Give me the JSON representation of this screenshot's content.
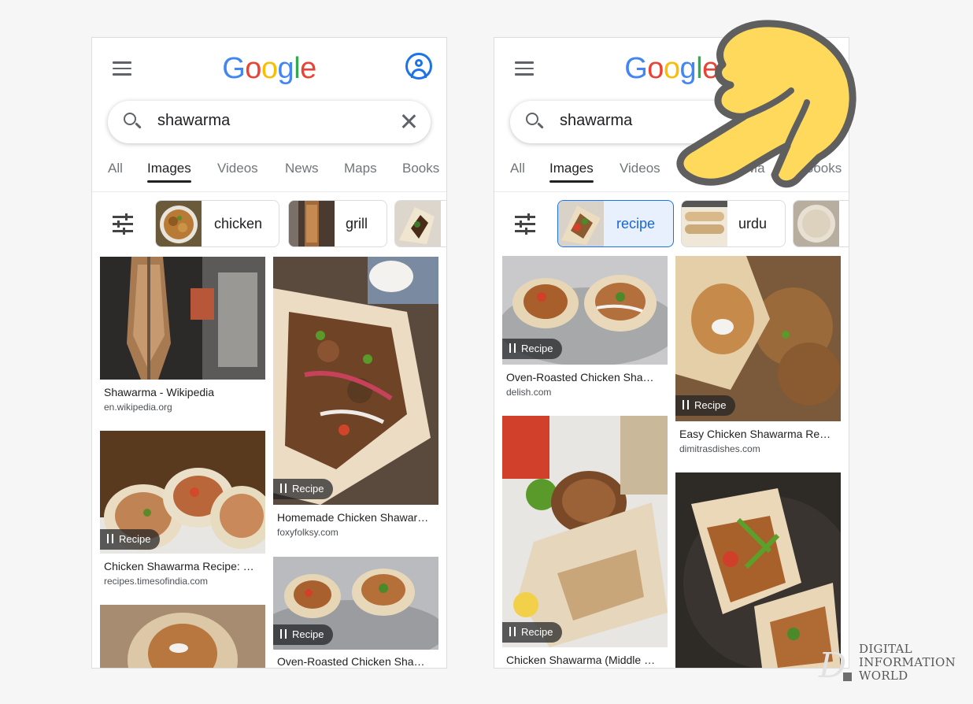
{
  "left_screen": {
    "logo": [
      "G",
      "o",
      "o",
      "g",
      "l",
      "e"
    ],
    "logo_colors": [
      "#4285f4",
      "#ea4335",
      "#fbbc05",
      "#4285f4",
      "#34a853",
      "#ea4335"
    ],
    "search": {
      "query": "shawarma"
    },
    "tabs": [
      "All",
      "Images",
      "Videos",
      "News",
      "Maps",
      "Books"
    ],
    "active_tab": "Images",
    "chips": [
      {
        "label": "chicken",
        "selected": false
      },
      {
        "label": "grill",
        "selected": false
      },
      {
        "label": "",
        "selected": false
      }
    ],
    "results": [
      {
        "caption": "Shawarma - Wikipedia",
        "source": "en.wikipedia.org",
        "badge": ""
      },
      {
        "caption": "Homemade Chicken Shawar…",
        "source": "foxyfolksy.com",
        "badge": "Recipe"
      },
      {
        "caption": "Chicken Shawarma Recipe: …",
        "source": "recipes.timesofindia.com",
        "badge": "Recipe"
      },
      {
        "caption": "Oven-Roasted Chicken Sha…",
        "source": "",
        "badge": "Recipe"
      },
      {
        "caption": "",
        "source": "",
        "badge": ""
      }
    ]
  },
  "right_screen": {
    "logo": [
      "G",
      "o",
      "o",
      "g",
      "l",
      "e"
    ],
    "logo_colors": [
      "#4285f4",
      "#ea4335",
      "#fbbc05",
      "#4285f4",
      "#34a853",
      "#ea4335"
    ],
    "search": {
      "query": "shawarma"
    },
    "tabs": [
      "All",
      "Images",
      "Videos",
      "Ma",
      "Books"
    ],
    "active_tab": "Images",
    "chips": [
      {
        "label": "recipe",
        "selected": true
      },
      {
        "label": "urdu",
        "selected": false
      },
      {
        "label": "",
        "selected": false
      }
    ],
    "results": [
      {
        "caption": "Oven-Roasted Chicken Sha…",
        "source": "delish.com",
        "badge": "Recipe"
      },
      {
        "caption": "Easy Chicken Shawarma Re…",
        "source": "dimitrasdishes.com",
        "badge": "Recipe"
      },
      {
        "caption": "Chicken Shawarma (Middle …",
        "source": "",
        "badge": "Recipe"
      },
      {
        "caption": "",
        "source": "",
        "badge": ""
      }
    ]
  },
  "watermark": {
    "lines": [
      "DIGITAL",
      "INFORMATION",
      "WORLD"
    ]
  },
  "colors": {
    "accent": "#1a73e8",
    "chip_selected_bg": "#e8f0fe",
    "hand_fill": "#fed95c",
    "hand_outline": "#5f5f5f"
  }
}
